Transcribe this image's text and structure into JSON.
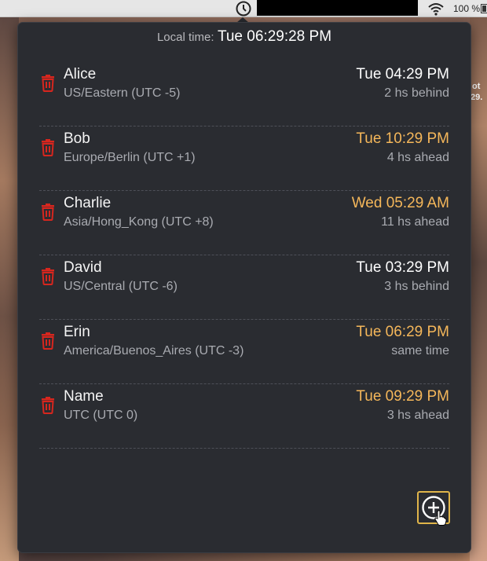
{
  "menubar": {
    "clock_icon": "clock-icon",
    "wifi_icon": "wifi-icon",
    "battery_percent": "100 %"
  },
  "desktop": {
    "text_1": "ot",
    "text_2": "29."
  },
  "popover": {
    "local_label": "Local time:",
    "local_value": "Tue 06:29:28 PM"
  },
  "people": [
    {
      "name": "Alice",
      "timezone": "US/Eastern (UTC -5)",
      "time": "Tue 04:29 PM",
      "diff": "2 hs behind",
      "time_color": "#ffffff"
    },
    {
      "name": "Bob",
      "timezone": "Europe/Berlin (UTC +1)",
      "time": "Tue 10:29 PM",
      "diff": "4 hs ahead",
      "time_color": "#f5b75a"
    },
    {
      "name": "Charlie",
      "timezone": "Asia/Hong_Kong (UTC +8)",
      "time": "Wed 05:29 AM",
      "diff": "11 hs ahead",
      "time_color": "#f5b75a"
    },
    {
      "name": "David",
      "timezone": "US/Central (UTC -6)",
      "time": "Tue 03:29 PM",
      "diff": "3 hs behind",
      "time_color": "#ffffff"
    },
    {
      "name": "Erin",
      "timezone": "America/Buenos_Aires (UTC -3)",
      "time": "Tue 06:29 PM",
      "diff": "same time",
      "time_color": "#f5b75a"
    },
    {
      "name": "Name",
      "timezone": "UTC (UTC 0)",
      "time": "Tue 09:29 PM",
      "diff": "3 hs ahead",
      "time_color": "#f5b75a"
    }
  ],
  "colors": {
    "trash": "#d7261e",
    "accent_time": "#f5b75a",
    "add_border": "#e0b54a",
    "panel": "#2a2c31"
  },
  "add_button_icon": "plus-circle-icon"
}
